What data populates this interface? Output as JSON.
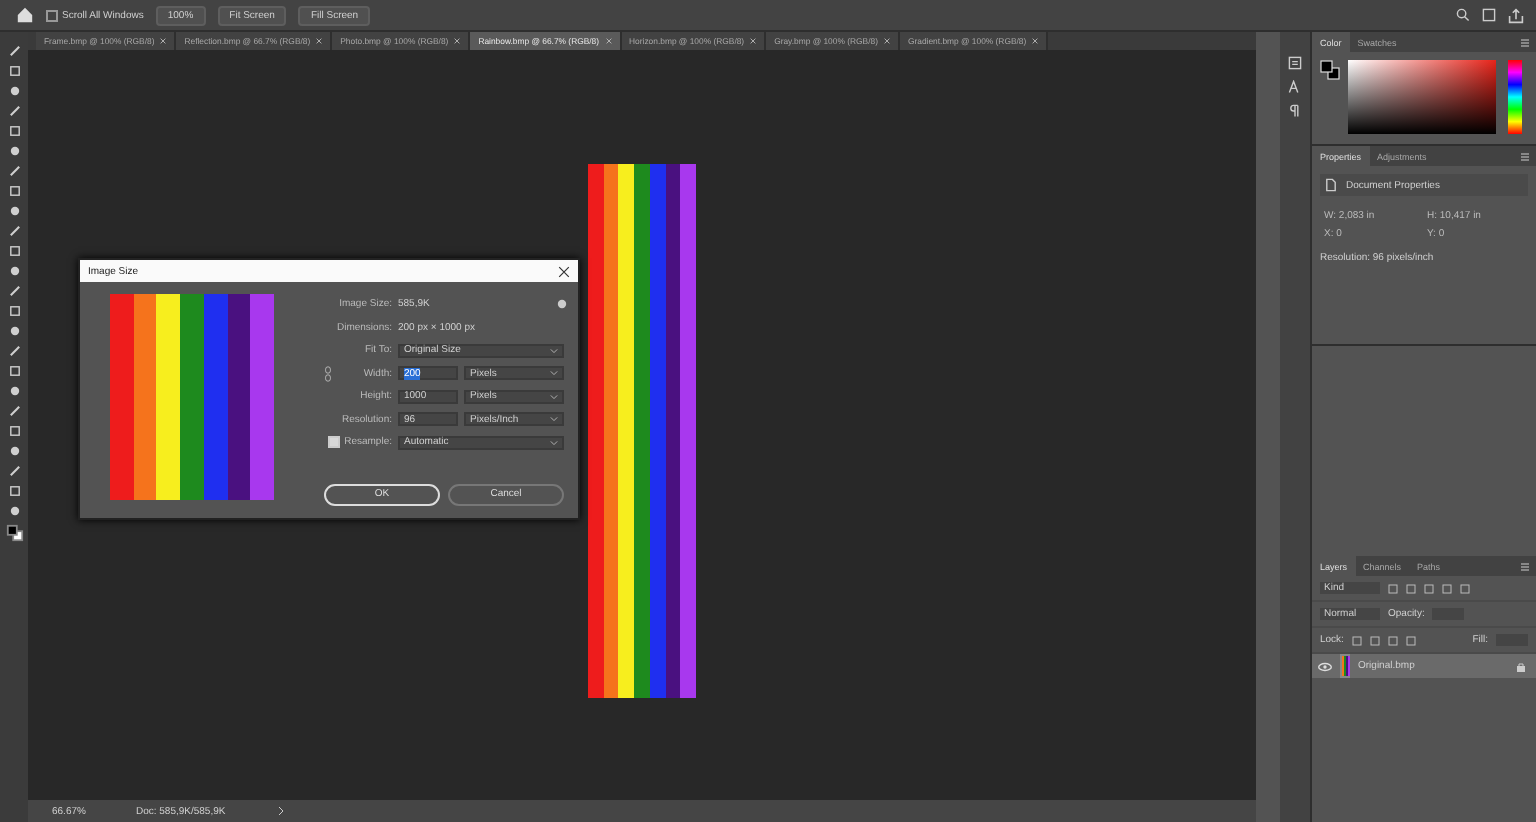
{
  "options_bar": {
    "scroll_all": {
      "label": "Scroll All Windows",
      "checked": false
    },
    "buttons": [
      "100%",
      "Fit Screen",
      "Fill Screen"
    ]
  },
  "tabs": [
    {
      "label": "Frame.bmp @ 100% (RGB/8)",
      "selected": false
    },
    {
      "label": "Reflection.bmp @ 66.7% (RGB/8)",
      "selected": false
    },
    {
      "label": "Photo.bmp @ 100% (RGB/8)",
      "selected": false
    },
    {
      "label": "Rainbow.bmp @ 66.7% (RGB/8)",
      "selected": true
    },
    {
      "label": "Horizon.bmp @ 100% (RGB/8)",
      "selected": false
    },
    {
      "label": "Gray.bmp @ 100% (RGB/8)",
      "selected": false
    },
    {
      "label": "Gradient.bmp @ 100% (RGB/8)",
      "selected": false
    }
  ],
  "canvas_stripes": [
    {
      "color": "#ee1c1c"
    },
    {
      "color": "#f5731c"
    },
    {
      "color": "#f7ee1e"
    },
    {
      "color": "#1e8a1e"
    },
    {
      "color": "#1f2ff0"
    },
    {
      "color": "#4a1180"
    },
    {
      "color": "#a838ee"
    }
  ],
  "dialog": {
    "title": "Image Size",
    "preview_stripes": [
      {
        "color": "#ee1c1c"
      },
      {
        "color": "#f5731c"
      },
      {
        "color": "#f7ee1e"
      },
      {
        "color": "#1e8a1e"
      },
      {
        "color": "#1f2ff0"
      },
      {
        "color": "#4a1180"
      },
      {
        "color": "#a838ee"
      }
    ],
    "image_size_label": "Image Size:",
    "image_size": "585,9K",
    "dimensions_label": "Dimensions:",
    "dimensions": "200 px  ×  1000 px",
    "fit_to_label": "Fit To:",
    "fit_to": "Original Size",
    "fields": [
      {
        "label": "Width:",
        "value": "200",
        "unit": "Pixels",
        "selected": true
      },
      {
        "label": "Height:",
        "value": "1000",
        "unit": "Pixels",
        "selected": false
      },
      {
        "label": "Resolution:",
        "value": "96",
        "unit": "Pixels/Inch",
        "selected": false
      }
    ],
    "resample": {
      "label": "Resample:",
      "checked": true,
      "value": "Automatic"
    },
    "buttons": [
      "OK",
      "Cancel"
    ]
  },
  "color_panel": {
    "tabs": [
      {
        "label": "Color",
        "selected": true
      },
      {
        "label": "Swatches",
        "selected": false
      }
    ]
  },
  "properties_panel": {
    "tabs": [
      {
        "label": "Properties",
        "selected": true
      },
      {
        "label": "Adjustments",
        "selected": false
      }
    ],
    "title": "Document Properties",
    "fields": [
      "W: 2,083 in",
      "H: 10,417 in",
      "X: 0",
      "Y: 0"
    ],
    "resolution": "Resolution: 96 pixels/inch"
  },
  "layers_panel": {
    "tabs": [
      {
        "label": "Layers",
        "selected": true
      },
      {
        "label": "Channels",
        "selected": false
      },
      {
        "label": "Paths",
        "selected": false
      }
    ],
    "filter": "Kind",
    "blend_mode": "Normal",
    "opacity_label": "Opacity:",
    "lock_label": "Lock:",
    "fill_label": "Fill:",
    "layers": [
      {
        "name": "Original.bmp",
        "visible": true,
        "selected": true
      }
    ]
  },
  "status_bar": {
    "zoom": "66.67%",
    "doc": "Doc: 585,9K/585,9K"
  }
}
